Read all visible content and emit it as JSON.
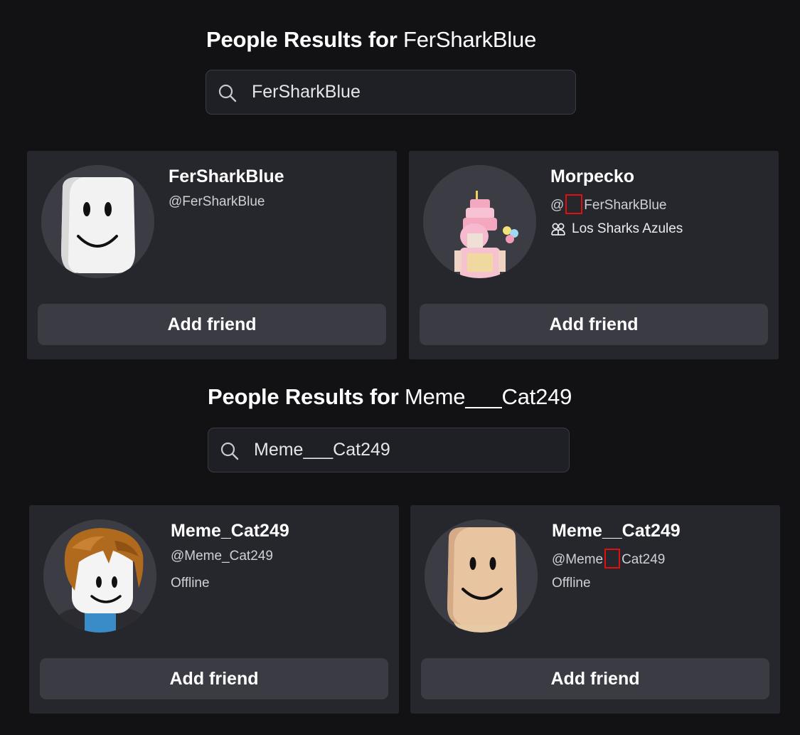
{
  "sections": [
    {
      "title_prefix": "People Results for",
      "query": "FerSharkBlue",
      "search_value": "FerSharkBlue",
      "results": [
        {
          "display_name": "FerSharkBlue",
          "username": "@FerSharkBlue",
          "button_label": "Add friend",
          "avatar": "white-blocky-head"
        },
        {
          "display_name": "Morpecko",
          "username_at": "@",
          "username_rest": "FerSharkBlue",
          "group_name": "Los Sharks Azules",
          "button_label": "Add friend",
          "avatar": "pink-cake-avatar"
        }
      ]
    },
    {
      "title_prefix": "People Results for",
      "query": "Meme___Cat249",
      "search_value": "Meme___Cat249",
      "results": [
        {
          "display_name": "Meme_Cat249",
          "username": "@Meme_Cat249",
          "status": "Offline",
          "button_label": "Add friend",
          "avatar": "brown-hair-avatar"
        },
        {
          "display_name": "Meme__Cat249",
          "username_prefix": "@Meme",
          "username_suffix": "Cat249",
          "status": "Offline",
          "button_label": "Add friend",
          "avatar": "tan-blocky-head"
        }
      ]
    }
  ],
  "colors": {
    "background": "#121215",
    "card": "#26272d",
    "button": "#3a3b43",
    "highlight_box": "#e01010"
  }
}
